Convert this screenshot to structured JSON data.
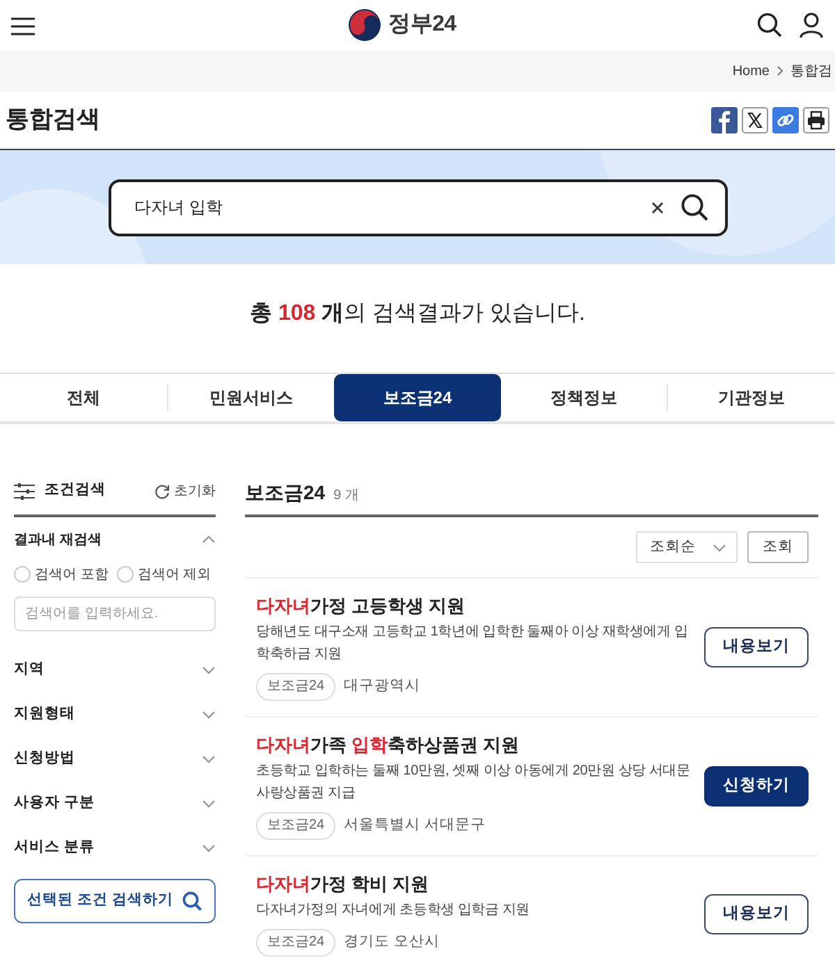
{
  "header": {
    "logo_text": "정부24"
  },
  "breadcrumb": [
    "Home",
    "통합검"
  ],
  "page_title": "통합검색",
  "search": {
    "value": "다자녀 입학"
  },
  "result_summary": {
    "prefix": "총",
    "count": "108",
    "suffix": "**개**의 검색결과가 있습니다."
  },
  "tabs": [
    {
      "label": "전체",
      "selected": false
    },
    {
      "label": "민원서비스",
      "selected": false
    },
    {
      "label": "보조금24",
      "selected": true
    },
    {
      "label": "정책정보",
      "selected": false
    },
    {
      "label": "기관정보",
      "selected": false
    }
  ],
  "sidebar": {
    "title": "조건검색",
    "reset": "초기화",
    "refine": {
      "title": "결과내 재검색",
      "expanded": true,
      "options": [
        {
          "label": "검색어 포함",
          "selected": false
        },
        {
          "label": "검색어 제외",
          "selected": false
        }
      ],
      "placeholder": "검색어를 입력하세요."
    },
    "filters": [
      {
        "label": "지역",
        "expanded": false
      },
      {
        "label": "지원형태",
        "expanded": false
      },
      {
        "label": "신청방법",
        "expanded": false
      },
      {
        "label": "사용자 구분",
        "expanded": false
      },
      {
        "label": "서비스 분류",
        "expanded": false
      }
    ],
    "submit": "선택된 조건 검색하기"
  },
  "results": {
    "title": "보조금24",
    "count": "9 개",
    "sort": {
      "value": "조회순"
    },
    "sort_button": "조회",
    "items": [
      {
        "title": [
          {
            "text": "다자녀",
            "highlight": true
          },
          {
            "text": "가정 고등학생 지원",
            "highlight": false
          }
        ],
        "description": "당해년도 대구소재 고등학교 1학년에 입학한 둘째아 이상 재학생에게 입학축하금 지원",
        "tag": "보조금24",
        "region": "대구광역시",
        "action": {
          "kind": "view",
          "label": "내용보기"
        }
      },
      {
        "title": [
          {
            "text": "다자녀",
            "highlight": true
          },
          {
            "text": "가족 ",
            "highlight": false
          },
          {
            "text": "입학",
            "highlight": true
          },
          {
            "text": "축하상품권 지원",
            "highlight": false
          }
        ],
        "description": "초등학교 입학하는 둘째 10만원, 셋째 이상 아동에게 20만원 상당 서대문사랑상품권 지급",
        "tag": "보조금24",
        "region": "서울특별시 서대문구",
        "action": {
          "kind": "apply",
          "label": "신청하기"
        }
      },
      {
        "title": [
          {
            "text": "다자녀",
            "highlight": true
          },
          {
            "text": "가정 학비 지원",
            "highlight": false
          }
        ],
        "description": "다자녀가정의 자녀에게 초등학생 입학금 지원",
        "tag": "보조금24",
        "region": "경기도 오산시",
        "action": {
          "kind": "view",
          "label": "내용보기"
        }
      }
    ]
  }
}
